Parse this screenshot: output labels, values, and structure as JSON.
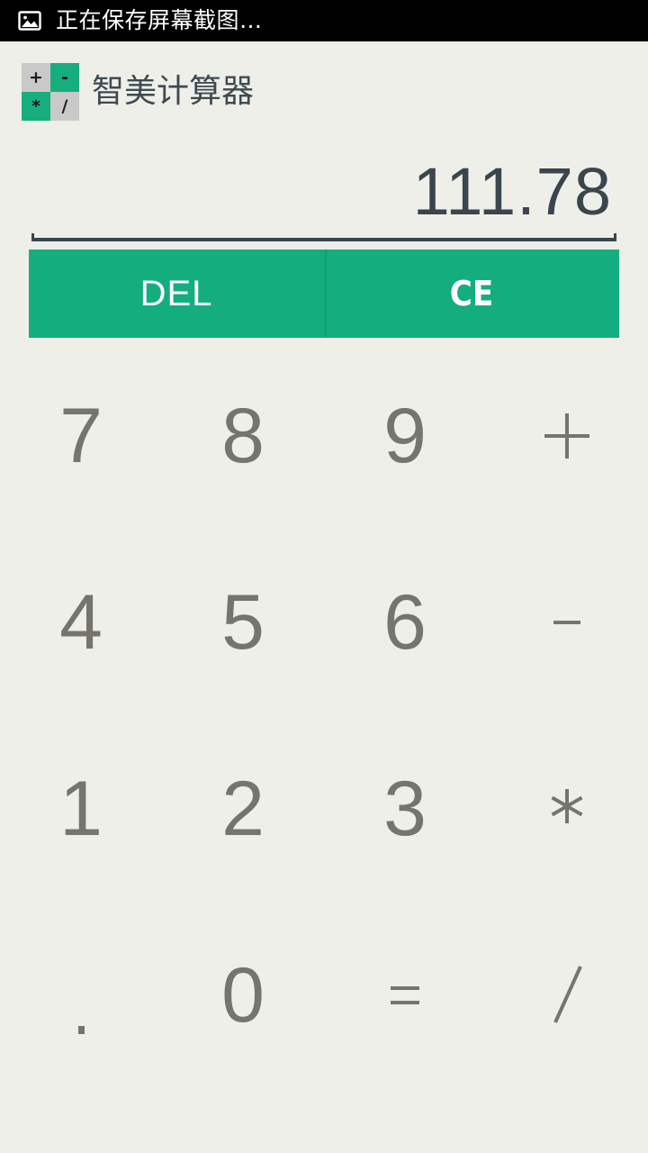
{
  "statusbar": {
    "icon": "image-icon",
    "text": "正在保存屏幕截图…"
  },
  "appbar": {
    "icon": {
      "name": "calculator-app-icon",
      "quadrants": [
        {
          "symbol": "+",
          "bg": "#c9c9c9"
        },
        {
          "symbol": "-",
          "bg": "#17ae7d"
        },
        {
          "symbol": "*",
          "bg": "#17ae7d"
        },
        {
          "symbol": "/",
          "bg": "#c9c9c9"
        }
      ]
    },
    "title": "智美计算器"
  },
  "display": {
    "value": "111.78"
  },
  "actions": {
    "delete_label": "DEL",
    "clear_label": "CE"
  },
  "keypad": {
    "keys": [
      {
        "label": "7",
        "type": "digit"
      },
      {
        "label": "8",
        "type": "digit"
      },
      {
        "label": "9",
        "type": "digit"
      },
      {
        "label": "+",
        "type": "operator"
      },
      {
        "label": "4",
        "type": "digit"
      },
      {
        "label": "5",
        "type": "digit"
      },
      {
        "label": "6",
        "type": "digit"
      },
      {
        "label": "-",
        "type": "operator"
      },
      {
        "label": "1",
        "type": "digit"
      },
      {
        "label": "2",
        "type": "digit"
      },
      {
        "label": "3",
        "type": "digit"
      },
      {
        "label": "*",
        "type": "operator"
      },
      {
        "label": ".",
        "type": "decimal"
      },
      {
        "label": "0",
        "type": "digit"
      },
      {
        "label": "=",
        "type": "equals"
      },
      {
        "label": "/",
        "type": "operator"
      }
    ]
  },
  "colors": {
    "background": "#efefe9",
    "accent_green": "#14ae7e",
    "accent_green_dark": "#0e8f68",
    "display_text": "#3a454d",
    "key_text": "#75756d",
    "statusbar_bg": "#000000",
    "icon_gray": "#c9c9c9"
  }
}
